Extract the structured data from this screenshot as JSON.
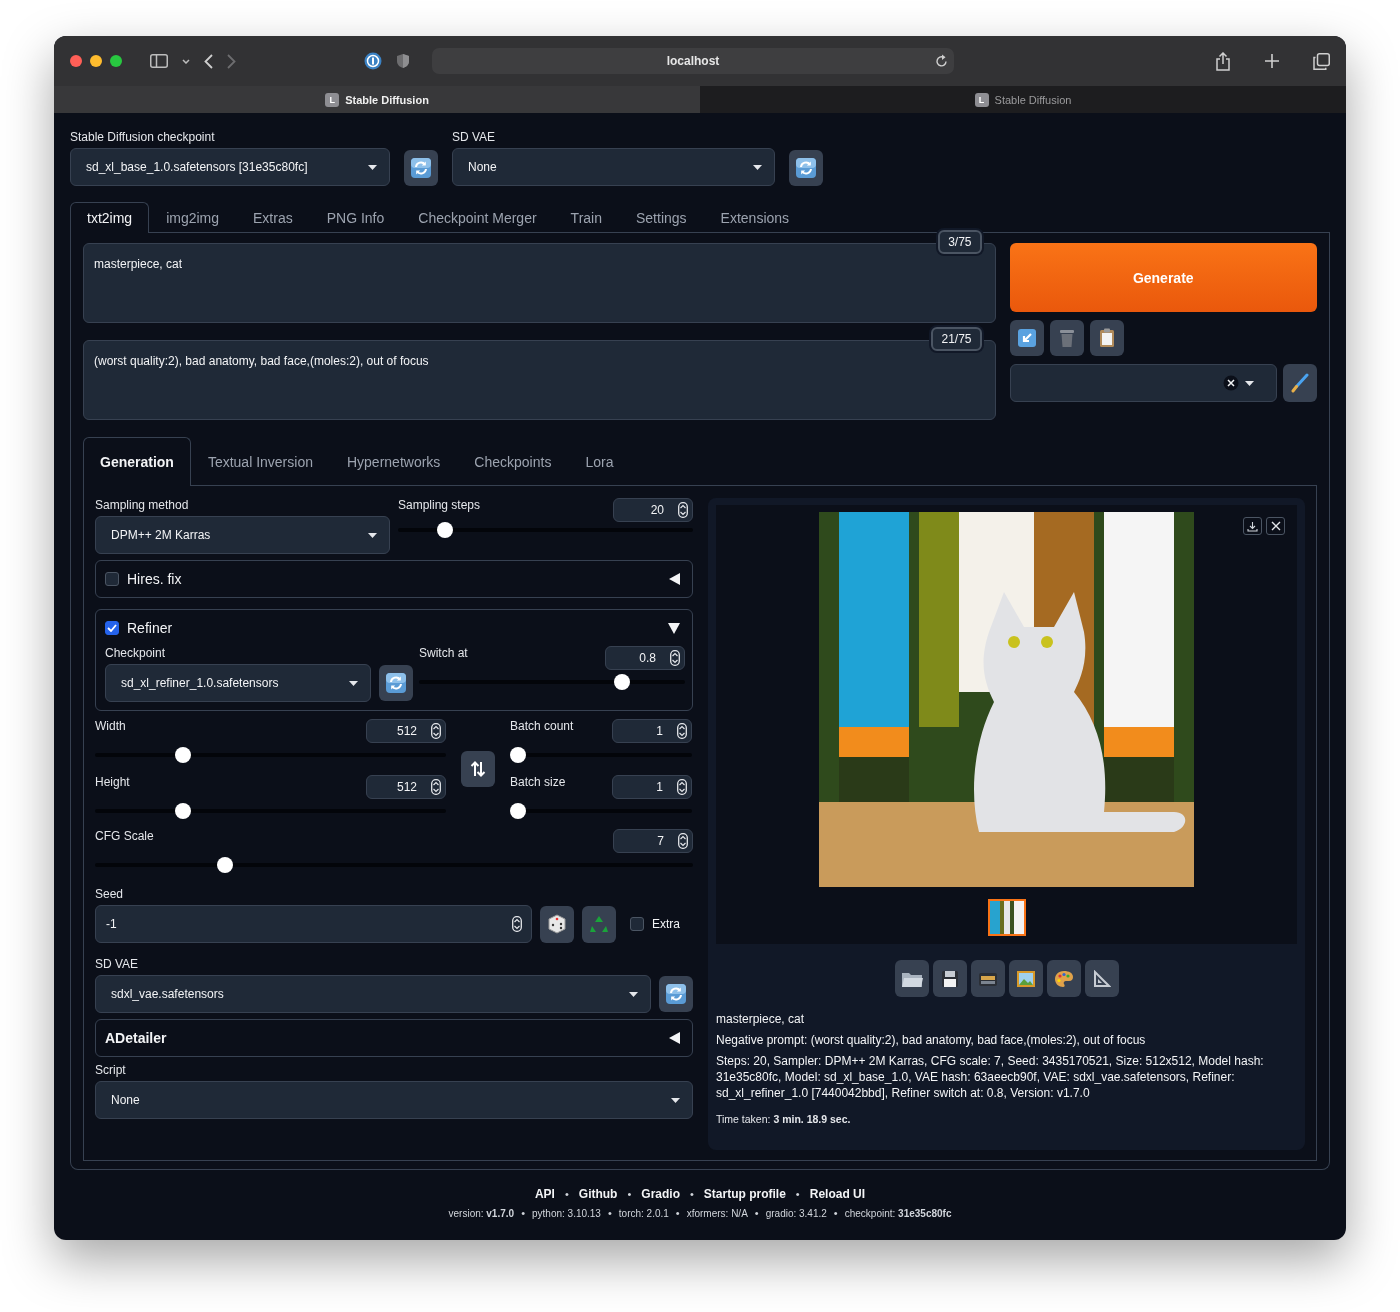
{
  "browser": {
    "url": "localhost",
    "tabs": [
      {
        "favicon": "L",
        "title": "Stable Diffusion",
        "selected": true
      },
      {
        "favicon": "L",
        "title": "Stable Diffusion",
        "selected": false
      }
    ]
  },
  "checkpoint": {
    "label": "Stable Diffusion checkpoint",
    "value": "sd_xl_base_1.0.safetensors [31e35c80fc]"
  },
  "vae": {
    "label": "SD VAE",
    "value": "None"
  },
  "main_tabs": [
    {
      "label": "txt2img",
      "selected": true
    },
    {
      "label": "img2img",
      "selected": false
    },
    {
      "label": "Extras",
      "selected": false
    },
    {
      "label": "PNG Info",
      "selected": false
    },
    {
      "label": "Checkpoint Merger",
      "selected": false
    },
    {
      "label": "Train",
      "selected": false
    },
    {
      "label": "Settings",
      "selected": false
    },
    {
      "label": "Extensions",
      "selected": false
    }
  ],
  "prompt": {
    "value": "masterpiece, cat",
    "counter": "3/75"
  },
  "negative_prompt": {
    "value": "(worst quality:2), bad anatomy, bad face,(moles:2), out of focus",
    "counter": "21/75"
  },
  "generate_button": "Generate",
  "sub_tabs": [
    {
      "label": "Generation",
      "selected": true
    },
    {
      "label": "Textual Inversion",
      "selected": false
    },
    {
      "label": "Hypernetworks",
      "selected": false
    },
    {
      "label": "Checkpoints",
      "selected": false
    },
    {
      "label": "Lora",
      "selected": false
    }
  ],
  "generation": {
    "sampling_method": {
      "label": "Sampling method",
      "value": "DPM++ 2M Karras"
    },
    "sampling_steps": {
      "label": "Sampling steps",
      "value": "20",
      "level": 0.14
    },
    "hires_fix": {
      "label": "Hires. fix",
      "checked": false,
      "expanded": false
    },
    "refiner": {
      "label": "Refiner",
      "checked": true,
      "expanded": true,
      "checkpoint": {
        "label": "Checkpoint",
        "value": "sd_xl_refiner_1.0.safetensors"
      },
      "switch_at": {
        "label": "Switch at",
        "value": "0.8",
        "level": 0.78
      }
    },
    "width": {
      "label": "Width",
      "value": "512",
      "level": 0.24
    },
    "height": {
      "label": "Height",
      "value": "512",
      "level": 0.24
    },
    "batch_count": {
      "label": "Batch count",
      "value": "1",
      "level": 0
    },
    "batch_size": {
      "label": "Batch size",
      "value": "1",
      "level": 0
    },
    "cfg_scale": {
      "label": "CFG Scale",
      "value": "7",
      "level": 0.21
    },
    "seed": {
      "label": "Seed",
      "value": "-1"
    },
    "extra": {
      "label": "Extra",
      "checked": false
    },
    "sd_vae": {
      "label": "SD VAE",
      "value": "sdxl_vae.safetensors"
    },
    "adetailer": {
      "label": "ADetailer",
      "expanded": false
    },
    "script": {
      "label": "Script",
      "value": "None"
    }
  },
  "output": {
    "info": [
      "masterpiece, cat",
      "Negative prompt: (worst quality:2), bad anatomy, bad face,(moles:2), out of focus",
      "Steps: 20, Sampler: DPM++ 2M Karras, CFG scale: 7, Seed: 3435170521, Size: 512x512, Model hash: 31e35c80fc, Model: sd_xl_base_1.0, VAE hash: 63aeecb90f, VAE: sdxl_vae.safetensors, Refiner: sd_xl_refiner_1.0 [7440042bbd], Refiner switch at: 0.8, Version: v1.7.0"
    ],
    "time_taken": "Time taken: **3 min. 18.9 sec.**"
  },
  "footer": {
    "links": [
      "API",
      "Github",
      "Gradio",
      "Startup profile",
      "Reload UI"
    ],
    "link_separators": [
      "•",
      "•",
      "•",
      "•"
    ],
    "versions": [
      "version: **v1.7.0**",
      "python: 3.10.13",
      "torch: 2.0.1",
      "xformers: N/A",
      "gradio: 3.41.2",
      "checkpoint: **31e35c80fc**"
    ],
    "version_separators": [
      "•",
      "•",
      "•",
      "•",
      "•"
    ]
  }
}
